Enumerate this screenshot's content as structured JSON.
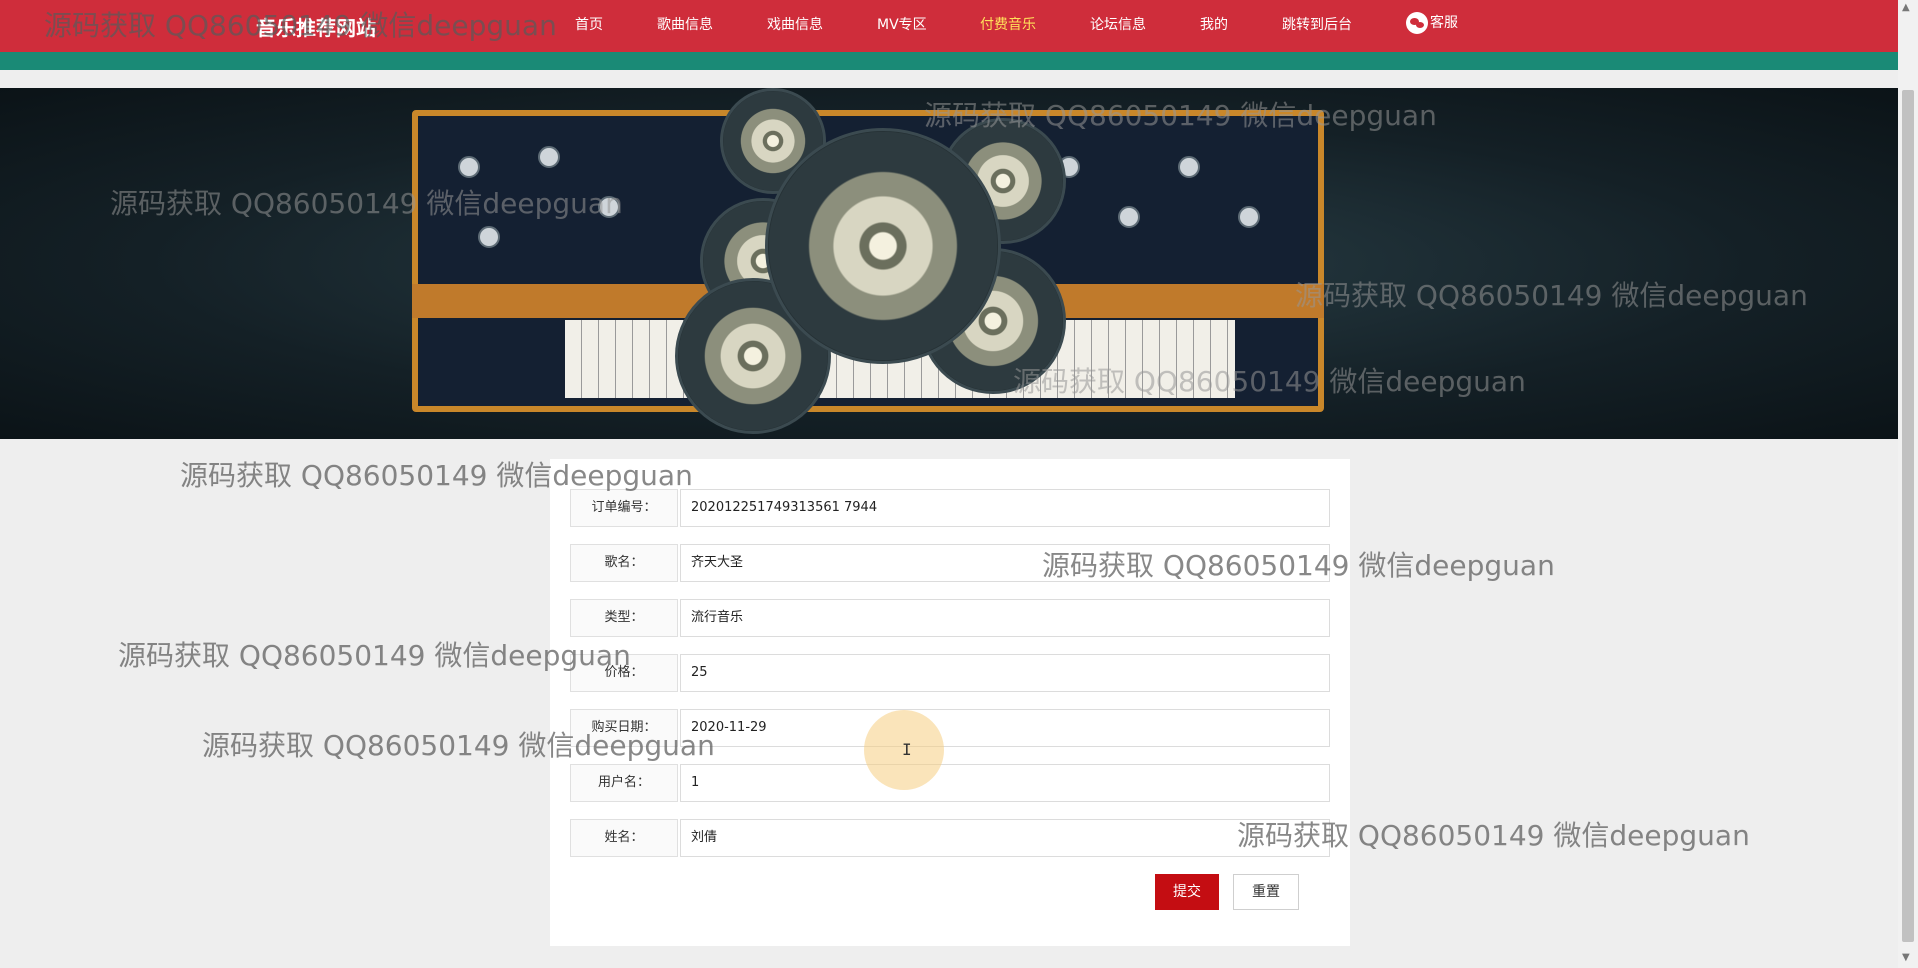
{
  "header": {
    "brand": "音乐推荐网站",
    "nav": [
      {
        "label": "首页"
      },
      {
        "label": "歌曲信息"
      },
      {
        "label": "戏曲信息"
      },
      {
        "label": "MV专区"
      },
      {
        "label": "付费音乐",
        "active": true
      },
      {
        "label": "论坛信息"
      },
      {
        "label": "我的"
      },
      {
        "label": "跳转到后台"
      }
    ],
    "service": {
      "label": "客服",
      "icon": "wechat-icon"
    }
  },
  "form": {
    "fields": [
      {
        "label": "订单编号：",
        "value": "202012251749313561 7944"
      },
      {
        "label": "歌名：",
        "value": "齐天大圣"
      },
      {
        "label": "类型：",
        "value": "流行音乐"
      },
      {
        "label": "价格：",
        "value": "25"
      },
      {
        "label": "购买日期：",
        "value": "2020-11-29"
      },
      {
        "label": "用户名：",
        "value": "1"
      },
      {
        "label": "姓名：",
        "value": "刘倩"
      }
    ],
    "submit_label": "提交",
    "reset_label": "重置"
  },
  "watermark_text": "源码获取 QQ86050149 微信deepguan",
  "colors": {
    "navbar": "#cf2d3b",
    "navbar_stripe": "#1a8a76",
    "active_nav": "#ffe05a",
    "submit": "#c40d12"
  }
}
